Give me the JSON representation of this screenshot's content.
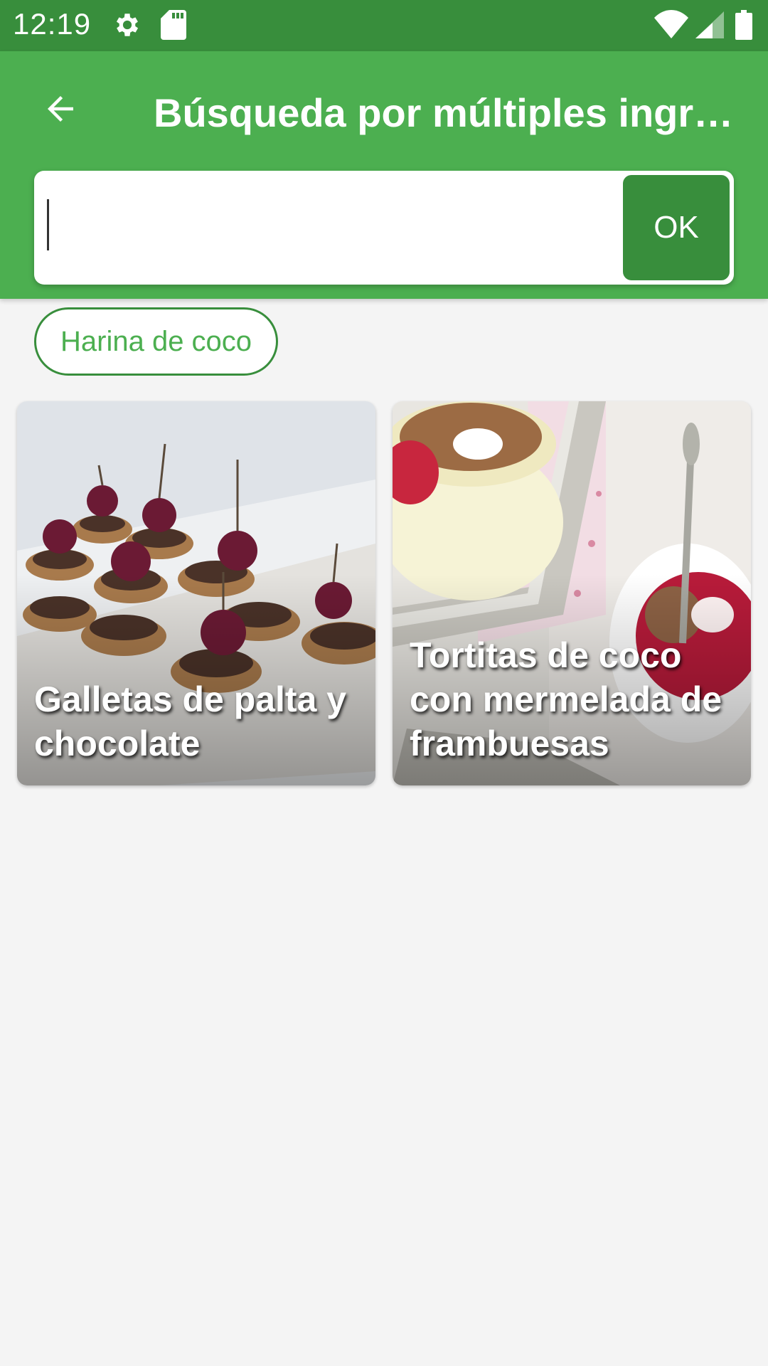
{
  "status_bar": {
    "time": "12:19",
    "icons": [
      "gear-icon",
      "sd-card-icon",
      "wifi-icon",
      "signal-icon",
      "battery-icon"
    ]
  },
  "app_bar": {
    "title": "Búsqueda por múltiples ingredientes",
    "back_icon": "arrow-left-icon",
    "background_color": "#4caf50"
  },
  "search": {
    "value": "",
    "placeholder": "",
    "ok_label": "OK",
    "ok_color": "#388e3c"
  },
  "chips": [
    {
      "label": "Harina de coco"
    }
  ],
  "recipes": [
    {
      "title": "Galletas de palta y chocolate"
    },
    {
      "title": "Tortitas de coco con mermelada de frambuesas"
    }
  ]
}
